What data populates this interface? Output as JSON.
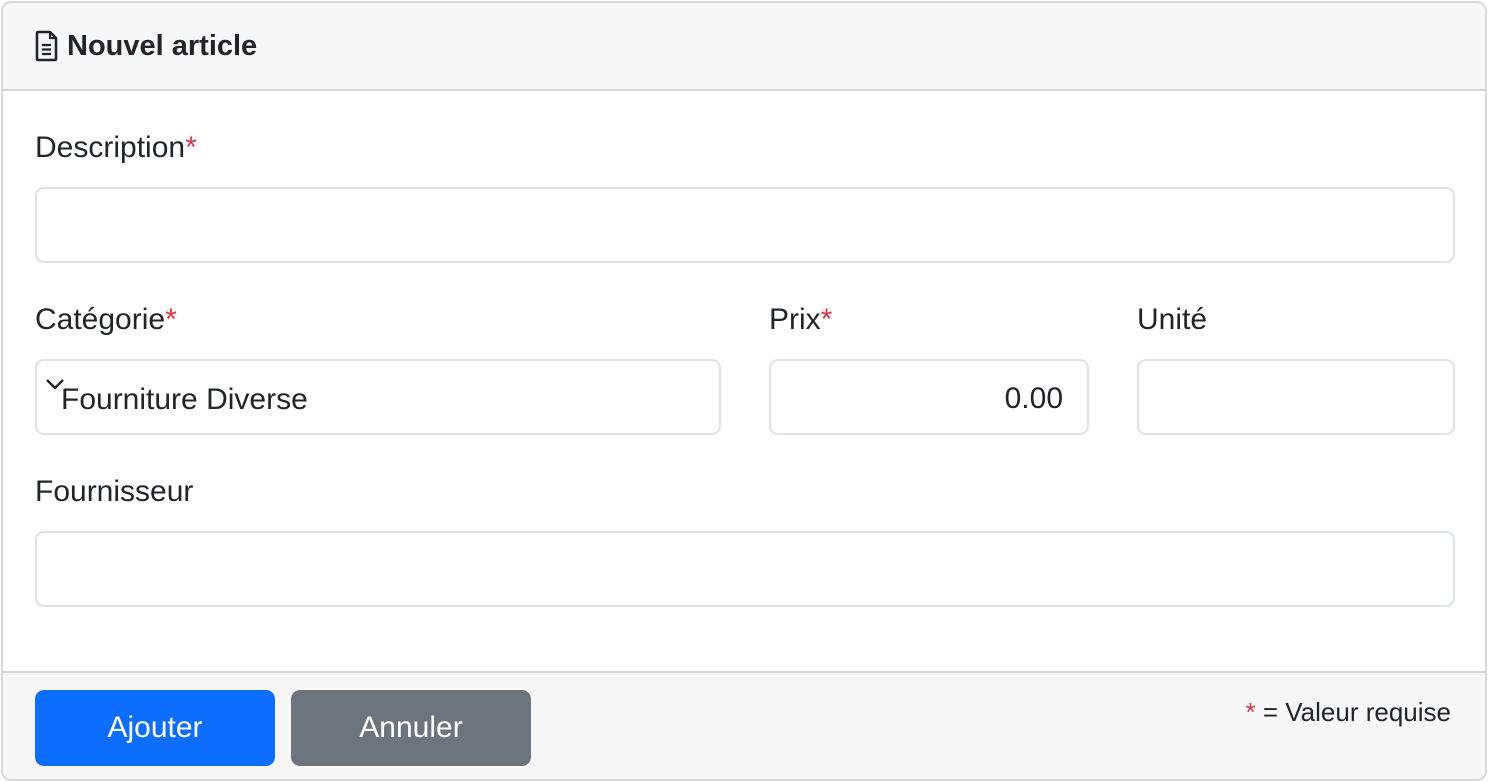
{
  "header": {
    "title": "Nouvel article",
    "icon": "file-text-icon"
  },
  "form": {
    "description": {
      "label": "Description",
      "required_mark": "*",
      "value": ""
    },
    "categorie": {
      "label": "Catégorie",
      "required_mark": "*",
      "value": "Fournitures Diverse",
      "display": "Fourniture Diverse"
    },
    "prix": {
      "label": "Prix",
      "required_mark": "*",
      "value": "0.00"
    },
    "unite": {
      "label": "Unité",
      "value": ""
    },
    "fournisseur": {
      "label": "Fournisseur",
      "value": ""
    }
  },
  "footer": {
    "add_label": "Ajouter",
    "cancel_label": "Annuler",
    "legend_mark": "*",
    "legend_text": "= Valeur requise"
  },
  "colors": {
    "primary": "#0d6efd",
    "secondary": "#6c757d",
    "required": "#dc3545"
  }
}
